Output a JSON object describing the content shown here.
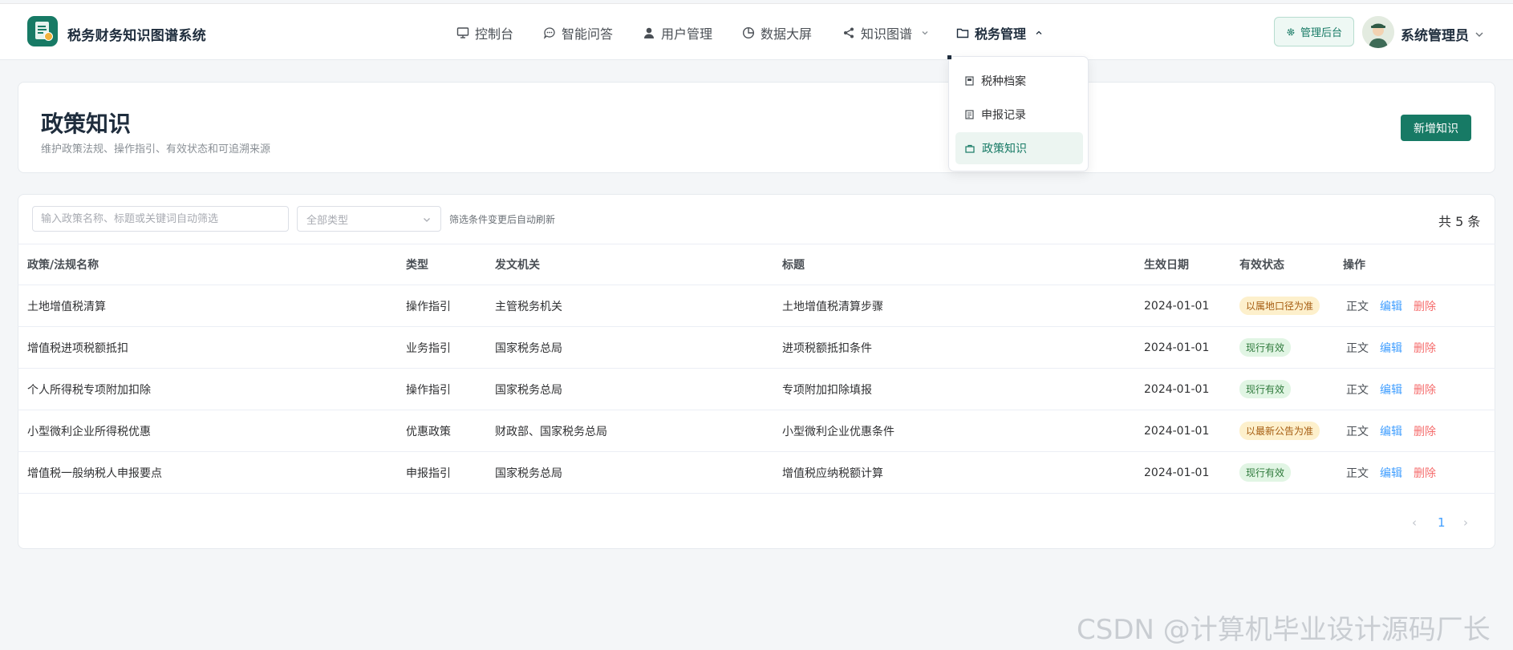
{
  "app": {
    "title": "税务财务知识图谱系统"
  },
  "nav": [
    {
      "label": "控制台",
      "icon": "monitor-icon"
    },
    {
      "label": "智能问答",
      "icon": "chat-icon"
    },
    {
      "label": "用户管理",
      "icon": "user-icon"
    },
    {
      "label": "数据大屏",
      "icon": "pie-chart-icon"
    },
    {
      "label": "知识图谱",
      "icon": "share-icon"
    },
    {
      "label": "税务管理",
      "icon": "folder-icon"
    }
  ],
  "header_right": {
    "admin_label": "管理后台",
    "user_name": "系统管理员"
  },
  "dropdown": {
    "items": [
      "税种档案",
      "申报记录",
      "政策知识"
    ],
    "selected": "政策知识"
  },
  "page": {
    "title": "政策知识",
    "subtitle": "维护政策法规、操作指引、有效状态和可追溯来源",
    "add_button": "新增知识"
  },
  "filters": {
    "search_placeholder": "输入政策名称、标题或关键词自动筛选",
    "type_placeholder": "全部类型",
    "hint": "筛选条件变更后自动刷新",
    "total": "共 5 条"
  },
  "table": {
    "columns": [
      "政策/法规名称",
      "类型",
      "发文机关",
      "标题",
      "生效日期",
      "有效状态",
      "操作"
    ],
    "rows": [
      {
        "name": "土地增值税清算",
        "type": "操作指引",
        "issuer": "主管税务机关",
        "title": "土地增值税清算步骤",
        "date": "2024-01-01",
        "status": "以属地口径为准",
        "status_color": "yellow"
      },
      {
        "name": "增值税进项税额抵扣",
        "type": "业务指引",
        "issuer": "国家税务总局",
        "title": "进项税额抵扣条件",
        "date": "2024-01-01",
        "status": "现行有效",
        "status_color": "green"
      },
      {
        "name": "个人所得税专项附加扣除",
        "type": "操作指引",
        "issuer": "国家税务总局",
        "title": "专项附加扣除填报",
        "date": "2024-01-01",
        "status": "现行有效",
        "status_color": "green"
      },
      {
        "name": "小型微利企业所得税优惠",
        "type": "优惠政策",
        "issuer": "财政部、国家税务总局",
        "title": "小型微利企业优惠条件",
        "date": "2024-01-01",
        "status": "以最新公告为准",
        "status_color": "yellow"
      },
      {
        "name": "增值税一般纳税人申报要点",
        "type": "申报指引",
        "issuer": "国家税务总局",
        "title": "增值税应纳税额计算",
        "date": "2024-01-01",
        "status": "现行有效",
        "status_color": "green"
      }
    ],
    "ops": {
      "view": "正文",
      "edit": "编辑",
      "delete": "删除"
    }
  },
  "pagination": {
    "prev": "‹",
    "current": "1",
    "next": "›"
  },
  "watermark": "CSDN @计算机毕业设计源码厂长",
  "colors": {
    "brand": "#177a65",
    "link": "#409eff",
    "danger": "#f56c6c"
  }
}
